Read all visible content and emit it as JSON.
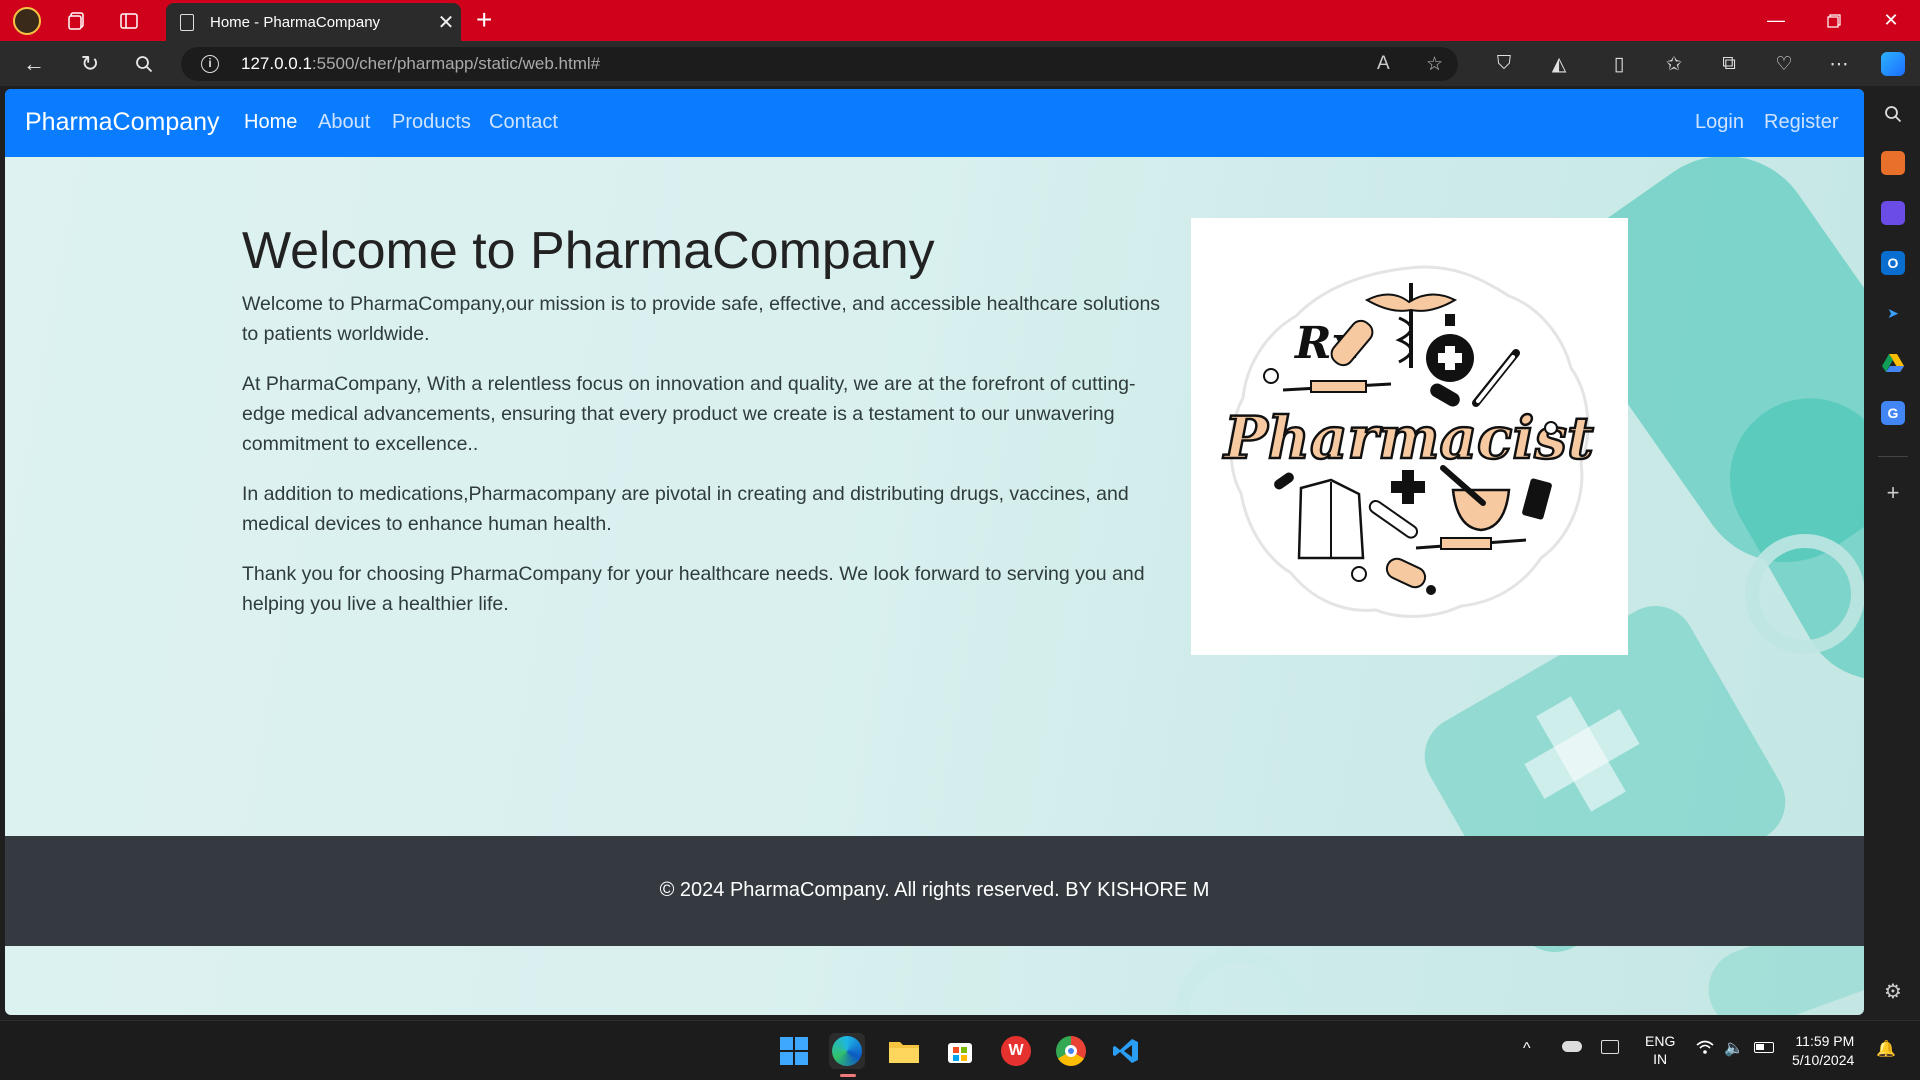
{
  "browser": {
    "tab_title": "Home - PharmaCompany",
    "url_host": "127.0.0.1",
    "url_rest": ":5500/cher/pharmapp/static/web.html#"
  },
  "site": {
    "brand": "PharmaCompany",
    "nav": {
      "home": "Home",
      "about": "About",
      "products": "Products",
      "contact": "Contact",
      "login": "Login",
      "register": "Register"
    },
    "hero": {
      "title": "Welcome to PharmaCompany",
      "paragraphs": [
        "Welcome to PharmaCompany,our mission is to provide safe, effective, and accessible healthcare solutions to patients worldwide.",
        "At PharmaCompany, With a relentless focus on innovation and quality, we are at the forefront of cutting-edge medical advancements, ensuring that every product we create is a testament to our unwavering commitment to excellence..",
        "In addition to medications,Pharmacompany are pivotal in creating and distributing drugs, vaccines, and medical devices to enhance human health.",
        "Thank you for choosing PharmaCompany for your healthcare needs. We look forward to serving you and helping you live a healthier life."
      ]
    },
    "image_label": "Pharmacist",
    "image_rx": "Rx",
    "footer": "© 2024 PharmaCompany. All rights reserved. BY KISHORE M"
  },
  "taskbar": {
    "lang1": "ENG",
    "lang2": "IN",
    "time": "11:59 PM",
    "date": "5/10/2024"
  },
  "colors": {
    "titlebar": "#d0021b",
    "navbar": "#0a7cff",
    "footer": "#343a40",
    "accent_teal": "#3fc2b4"
  }
}
